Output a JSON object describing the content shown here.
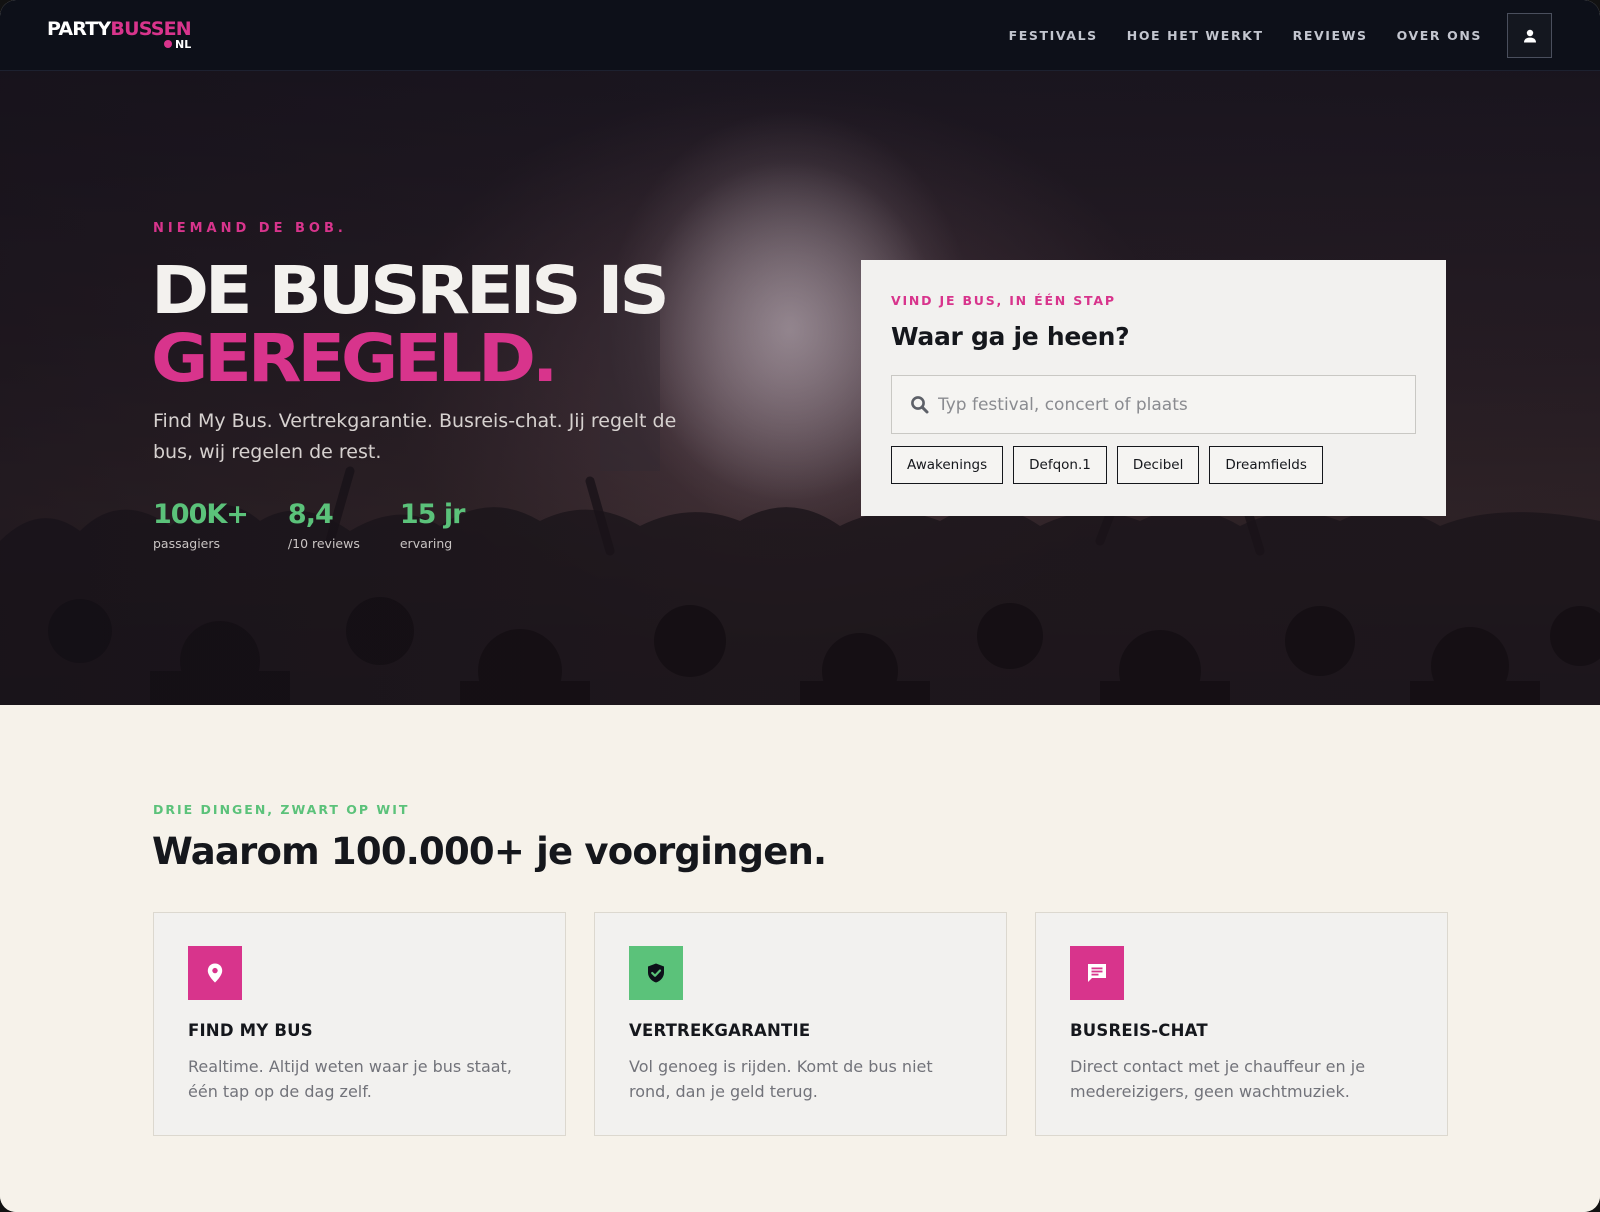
{
  "nav": {
    "logo_party": "PARTY",
    "logo_bussen": "BUSSEN",
    "logo_nl": "NL",
    "links": [
      "FESTIVALS",
      "HOE HET WERKT",
      "REVIEWS",
      "OVER ONS"
    ],
    "user_icon": "user-icon"
  },
  "hero": {
    "eyebrow": "NIEMAND DE BOB.",
    "title_line1": "DE BUSREIS IS",
    "title_line2": "GEREGELD.",
    "subtitle": "Find My Bus. Vertrekgarantie. Busreis-chat. Jij regelt de bus, wij regelen de rest.",
    "stats": [
      {
        "value": "100K+",
        "label": "passagiers"
      },
      {
        "value": "8,4",
        "label": "/10 reviews"
      },
      {
        "value": "15 jr",
        "label": "ervaring"
      }
    ]
  },
  "search_card": {
    "eyebrow": "VIND JE BUS, IN ÉÉN STAP",
    "title": "Waar ga je heen?",
    "placeholder": "Typ festival, concert of plaats",
    "value": "",
    "chips": [
      "Awakenings",
      "Defqon.1",
      "Decibel",
      "Dreamfields"
    ]
  },
  "why": {
    "eyebrow": "DRIE DINGEN, ZWART OP WIT",
    "title": "Waarom 100.000+ je voorgingen.",
    "features": [
      {
        "icon": "location-pin-icon",
        "color": "#d8348c",
        "title": "FIND MY BUS",
        "text": "Realtime. Altijd weten waar je bus staat, één tap op de dag zelf."
      },
      {
        "icon": "shield-check-icon",
        "color": "#5bc27a",
        "title": "VERTREKGARANTIE",
        "text": "Vol genoeg is rijden. Komt de bus niet rond, dan je geld terug."
      },
      {
        "icon": "chat-icon",
        "color": "#d8348c",
        "title": "BUSREIS-CHAT",
        "text": "Direct contact met je chauffeur en je medereizigers, geen wachtmuziek."
      }
    ]
  },
  "colors": {
    "brand_pink": "#d8348c",
    "brand_green": "#5bc27a",
    "nav_bg": "#0d1019",
    "section_bg": "#f6f2ea"
  }
}
